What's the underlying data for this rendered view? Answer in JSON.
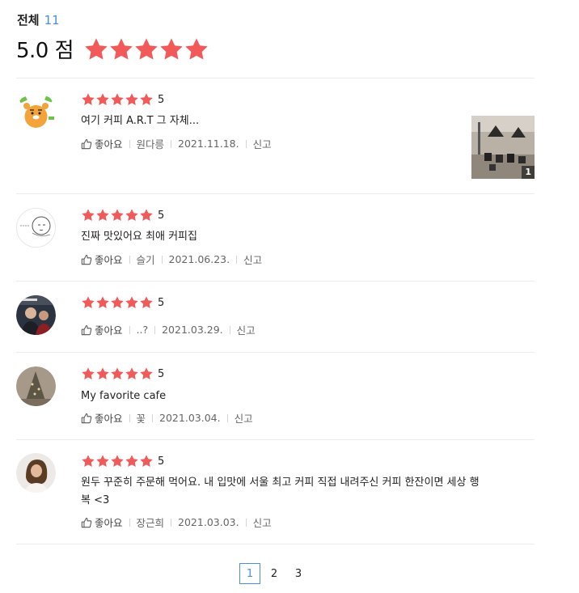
{
  "summary": {
    "label": "전체",
    "count": "11",
    "score": "5.0 점",
    "star_color": "#f25a5a"
  },
  "reviews": [
    {
      "avatar": "ryan-character-avatar",
      "rating": "5",
      "text": "여기 커피 A.R.T 그 자체...",
      "like_label": "좋아요",
      "author": "원다릉",
      "date": "2021.11.18.",
      "report_label": "신고",
      "photo_count": "1"
    },
    {
      "avatar": "sketch-face-avatar",
      "rating": "5",
      "text": "진짜 맛있어요 최애 커피집",
      "like_label": "좋아요",
      "author": "슬기",
      "date": "2021.06.23.",
      "report_label": "신고"
    },
    {
      "avatar": "people-photo-avatar",
      "rating": "5",
      "text": "",
      "like_label": "좋아요",
      "author": "..?",
      "date": "2021.03.29.",
      "report_label": "신고"
    },
    {
      "avatar": "tree-photo-avatar",
      "rating": "5",
      "text": "My favorite cafe",
      "like_label": "좋아요",
      "author": "꽃",
      "date": "2021.03.04.",
      "report_label": "신고"
    },
    {
      "avatar": "woman-photo-avatar",
      "rating": "5",
      "text": "원두 꾸준히 주문해 먹어요.  내 입맛에 서울 최고 커피  직접 내려주신 커피 한잔이면 세상 행",
      "text2": "복 <3",
      "like_label": "좋아요",
      "author": "장근희",
      "date": "2021.03.03.",
      "report_label": "신고"
    }
  ],
  "pagination": {
    "pages": [
      "1",
      "2",
      "3"
    ],
    "current": "1"
  }
}
